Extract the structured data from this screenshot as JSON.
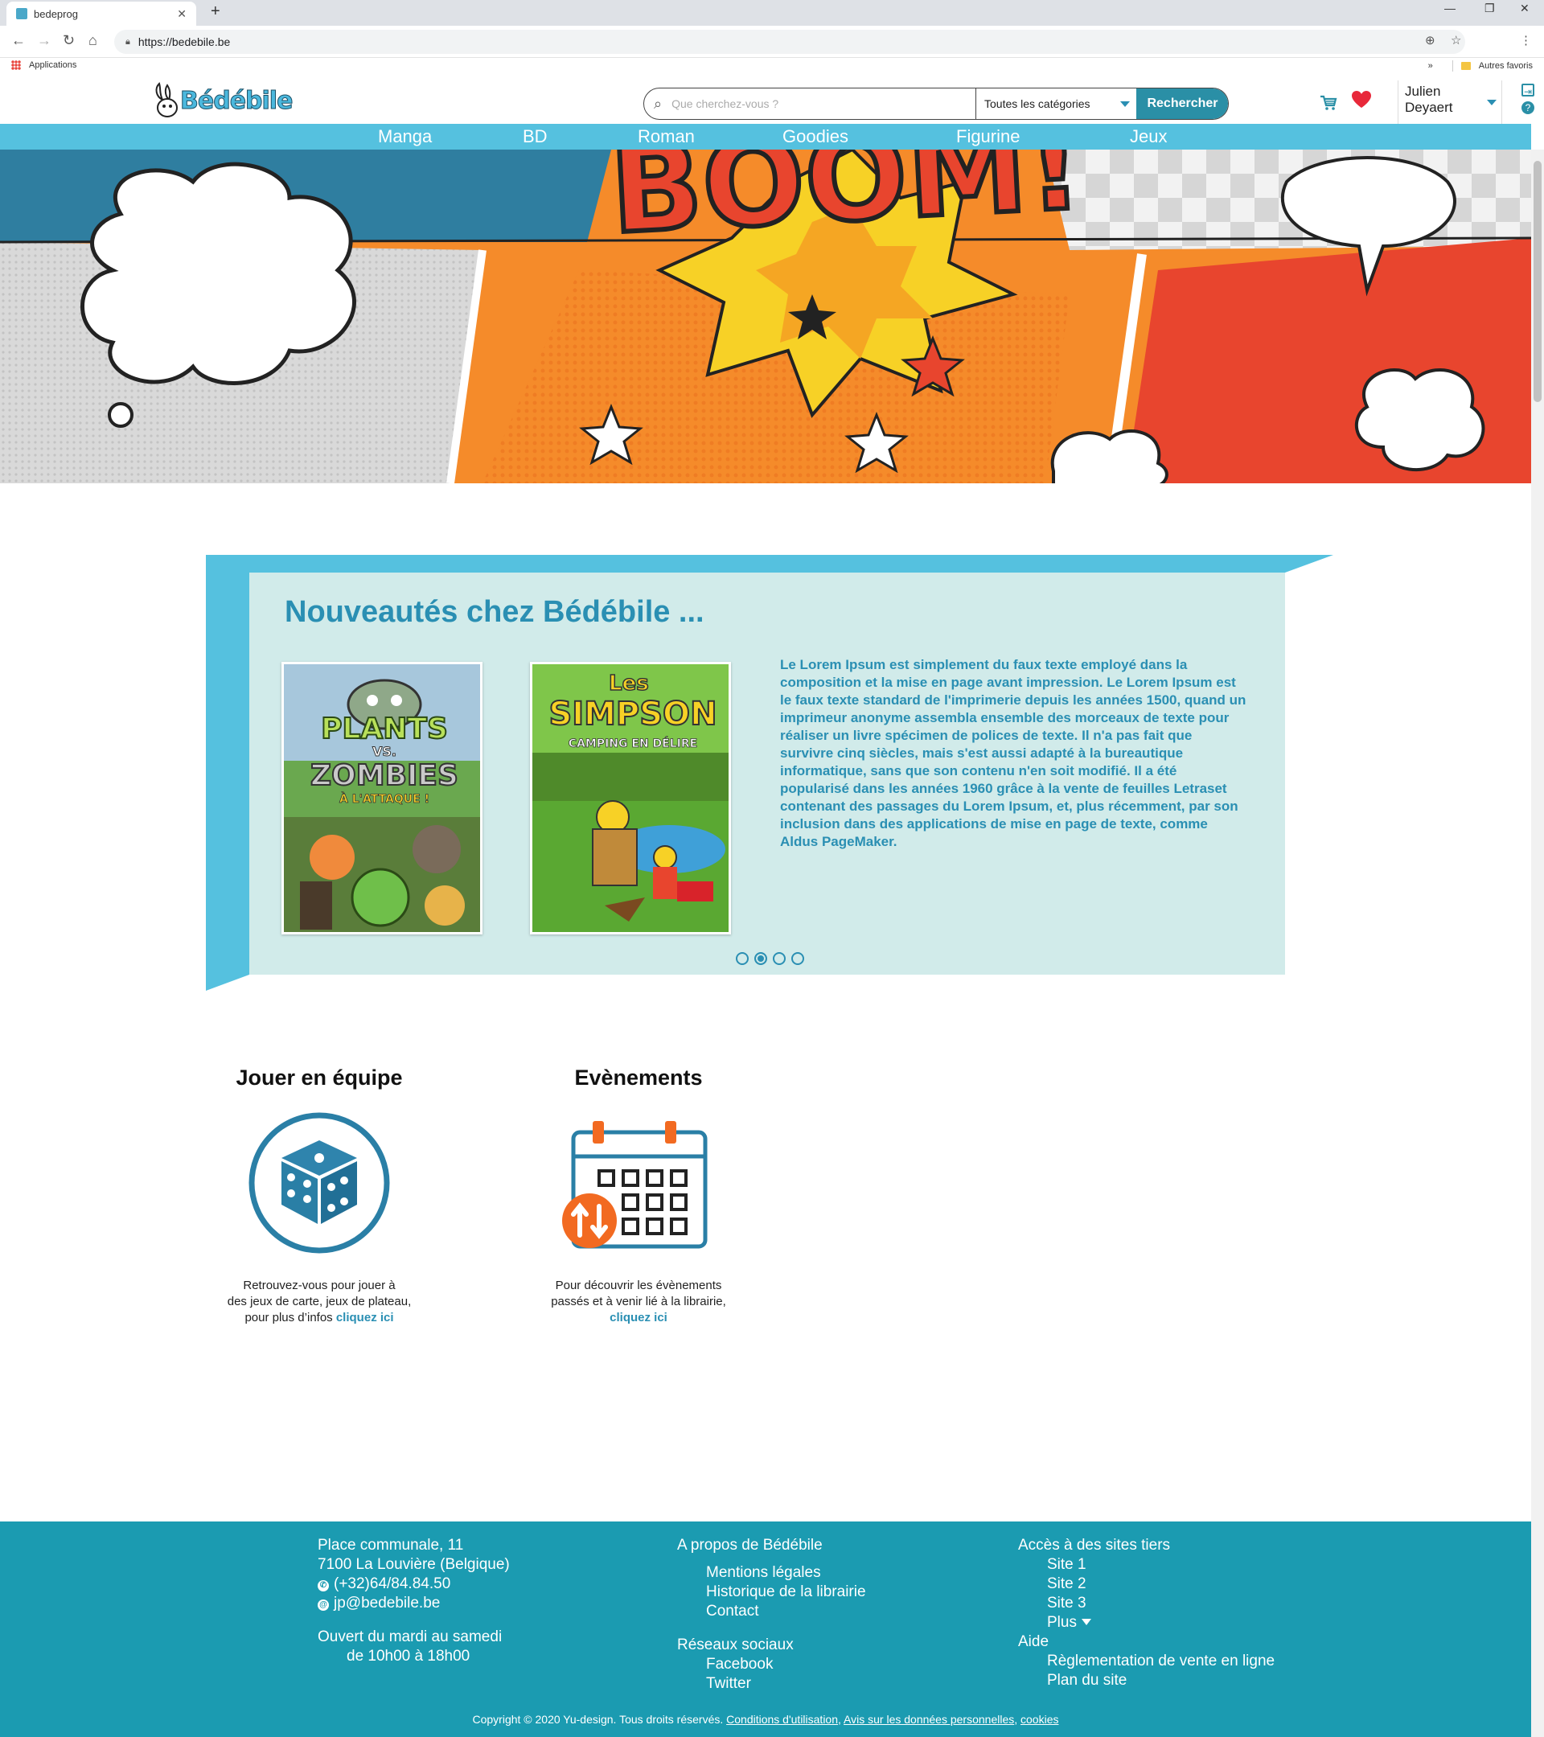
{
  "browser": {
    "tab_title": "bedeprog",
    "url": "https://bedebile.be",
    "bookmarks_apps": "Applications",
    "bookmarks_other": "Autres favoris",
    "bookmarks_more": "»"
  },
  "header": {
    "logo_text": "Bédébile",
    "search_placeholder": "Que cherchez-vous ?",
    "category_select": "Toutes les catégories",
    "search_button": "Rechercher",
    "user_first": "Julien",
    "user_last": "Deyaert"
  },
  "nav": {
    "items": [
      "Manga",
      "BD",
      "Roman",
      "Goodies",
      "Figurine",
      "Jeux"
    ]
  },
  "hero": {
    "word": "BOOM!"
  },
  "news": {
    "title": "Nouveautés chez Bédébile ...",
    "book1": {
      "line1": "PLANTS",
      "line2": "VS.",
      "line3": "ZOMBIES",
      "line4": "À L'ATTAQUE !"
    },
    "book2": {
      "line1": "Les",
      "line2": "SIMPSON",
      "line3": "CAMPING EN DÉLIRE"
    },
    "text": "Le Lorem Ipsum est simplement du faux texte employé dans la composition et la mise en page avant impression. Le Lorem Ipsum est le faux texte standard de l'imprimerie depuis les années 1500, quand un imprimeur anonyme assembla ensemble des morceaux de texte pour réaliser un livre spécimen de polices de texte. Il n'a pas fait que survivre cinq siècles, mais s'est aussi adapté à la bureautique informatique, sans que son contenu n'en soit modifié. Il a été popularisé dans les années 1960 grâce à la vente de feuilles Letraset contenant des passages du Lorem Ipsum, et, plus récemment, par son inclusion dans des applications de mise en page de texte, comme Aldus PageMaker.",
    "carousel_count": 4,
    "carousel_active": 1
  },
  "features": {
    "team": {
      "title": "Jouer en équipe",
      "line1": "Retrouvez-vous pour jouer à",
      "line2": "des jeux de carte, jeux de plateau,",
      "line3": "pour plus d’infos",
      "link": "cliquez ici",
      "icon": "dice-icon"
    },
    "events": {
      "title": "Evènements",
      "line1": "Pour découvrir les évènements",
      "line2": "passés et à venir lié à la librairie,",
      "link": "cliquez ici",
      "icon": "calendar-icon"
    }
  },
  "footer": {
    "address1": "Place communale, 11",
    "address2": "7100 La Louvière (Belgique)",
    "phone": "(+32)64/84.84.50",
    "email": "jp@bedebile.be",
    "hours1": "Ouvert du mardi au samedi",
    "hours2": "de 10h00 à 18h00",
    "about_title": "A propos de Bédébile",
    "about_links": [
      "Mentions légales",
      "Historique de la librairie",
      "Contact"
    ],
    "social_title": "Réseaux sociaux",
    "social_links": [
      "Facebook",
      "Twitter"
    ],
    "third_title": "Accès à des sites tiers",
    "third_links": [
      "Site 1",
      "Site 2",
      "Site 3"
    ],
    "third_more": "Plus",
    "help_title": "Aide",
    "help_links": [
      "Règlementation de vente en ligne",
      "Plan du site"
    ],
    "copyright": "Copyright © 2020 Yu-design. Tous droits réservés.",
    "terms": "Conditions d'utilisation",
    "privacy": "Avis sur les données personnelles",
    "cookies": "cookies"
  },
  "colors": {
    "brand": "#2a8fb3",
    "nav_bar": "#55c1df",
    "footer": "#1b9bb1",
    "news_panel": "#d1ebea",
    "favorite": "#e8283a"
  }
}
